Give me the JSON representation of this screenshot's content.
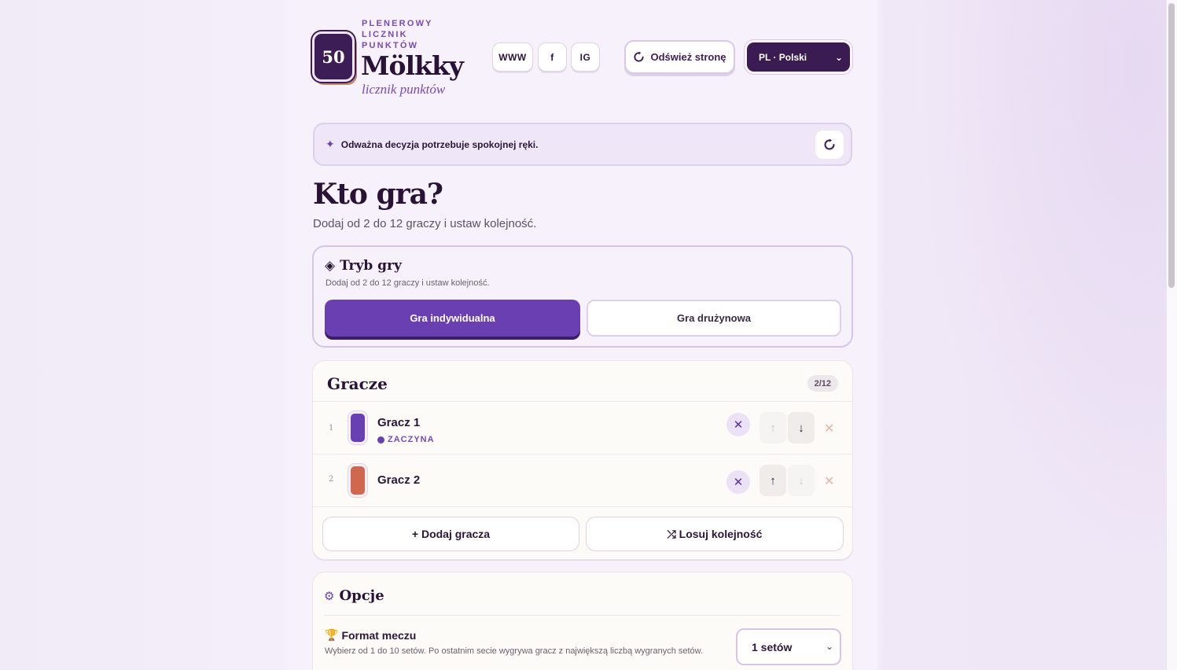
{
  "brand": {
    "badge": "50",
    "kicker": "PLENEROWY LICZNIK PUNKTÓW",
    "title": "Mölkky",
    "subtitle": "licznik punktów"
  },
  "header": {
    "links": [
      "WWW",
      "f",
      "IG"
    ],
    "refresh_label": "Odśwież stronę",
    "language": "PL · Polski"
  },
  "tip": {
    "text": "Odważna decyzja potrzebuje spokojnej ręki."
  },
  "setup": {
    "title": "Kto gra?",
    "subtitle": "Dodaj od 2 do 12 graczy i ustaw kolejność."
  },
  "mode": {
    "title": "Tryb gry",
    "description": "Dodaj od 2 do 12 graczy i ustaw kolejność.",
    "individual": "Gra indywidualna",
    "team": "Gra drużynowa",
    "selected": "individual"
  },
  "players": {
    "title": "Gracze",
    "count": "2/12",
    "starts_label": "ZACZYNA",
    "list": [
      {
        "number": "1",
        "name": "Gracz 1",
        "color": "#6a3fb2",
        "starts": true
      },
      {
        "number": "2",
        "name": "Gracz 2",
        "color": "#d0684f",
        "starts": false
      }
    ],
    "add_label": "+ Dodaj gracza",
    "shuffle_label": "⤮ Losuj kolejność"
  },
  "options": {
    "title": "Opcje",
    "format_title": "Format meczu",
    "format_desc": "Wybierz od 1 do 10 setów. Po ostatnim secie wygrywa gracz z największą liczbą wygranych setów.",
    "format_value": "1 setów"
  },
  "colors": {
    "accent": "#6a3fb2",
    "dark": "#3a1b52"
  }
}
